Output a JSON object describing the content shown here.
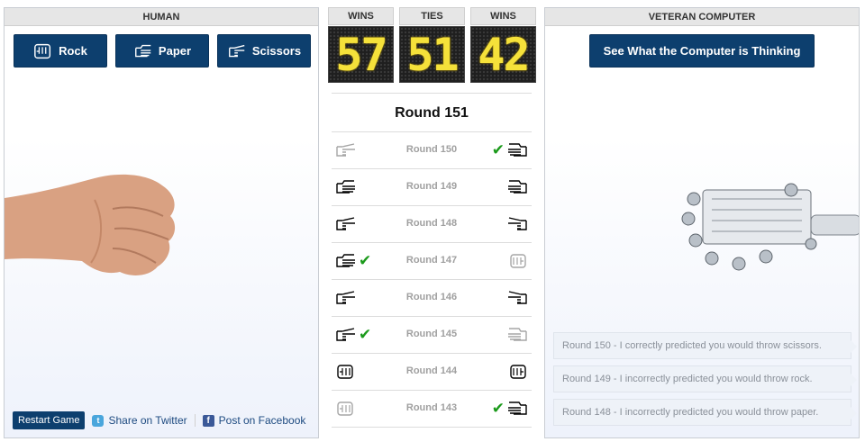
{
  "human": {
    "header": "HUMAN",
    "buttons": {
      "rock": "Rock",
      "paper": "Paper",
      "scissors": "Scissors"
    },
    "restart": "Restart Game",
    "twitter": "Share on Twitter",
    "facebook": "Post on Facebook"
  },
  "computer": {
    "header": "VETERAN COMPUTER",
    "think_button": "See What the Computer is Thinking",
    "messages": [
      "Round 150 - I correctly predicted you would throw scissors.",
      "Round 149 - I incorrectly predicted you would throw rock.",
      "Round 148 - I incorrectly predicted you would throw paper."
    ]
  },
  "scores": {
    "human_label": "WINS",
    "human_wins": "57",
    "ties_label": "TIES",
    "ties": "51",
    "computer_label": "WINS",
    "computer_wins": "42"
  },
  "current_round": "Round 151",
  "history": [
    {
      "label": "Round 150",
      "human": "scissors",
      "computer": "paper",
      "winner": "computer"
    },
    {
      "label": "Round 149",
      "human": "paper",
      "computer": "paper",
      "winner": "tie"
    },
    {
      "label": "Round 148",
      "human": "scissors",
      "computer": "scissors",
      "winner": "tie"
    },
    {
      "label": "Round 147",
      "human": "paper",
      "computer": "rock",
      "winner": "human"
    },
    {
      "label": "Round 146",
      "human": "scissors",
      "computer": "scissors",
      "winner": "tie"
    },
    {
      "label": "Round 145",
      "human": "scissors",
      "computer": "paper",
      "winner": "human"
    },
    {
      "label": "Round 144",
      "human": "rock",
      "computer": "rock",
      "winner": "tie"
    },
    {
      "label": "Round 143",
      "human": "rock",
      "computer": "paper",
      "winner": "computer"
    }
  ],
  "colors": {
    "button": "#0d3f6e",
    "check": "#1b9a1b",
    "digits": "#f5e13a"
  }
}
